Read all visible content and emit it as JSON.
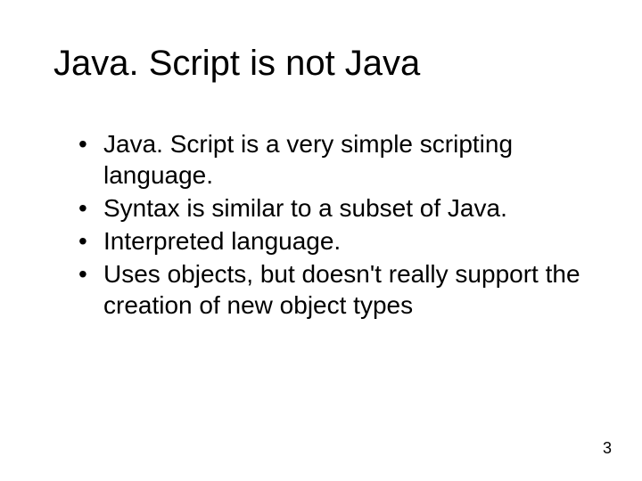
{
  "slide": {
    "title": "Java. Script  is not Java",
    "bullets": [
      " Java. Script is a very simple scripting language.",
      " Syntax is similar to a subset of Java.",
      " Interpreted language.",
      " Uses objects, but doesn't really support the creation of new object types"
    ],
    "page_number": "3"
  }
}
